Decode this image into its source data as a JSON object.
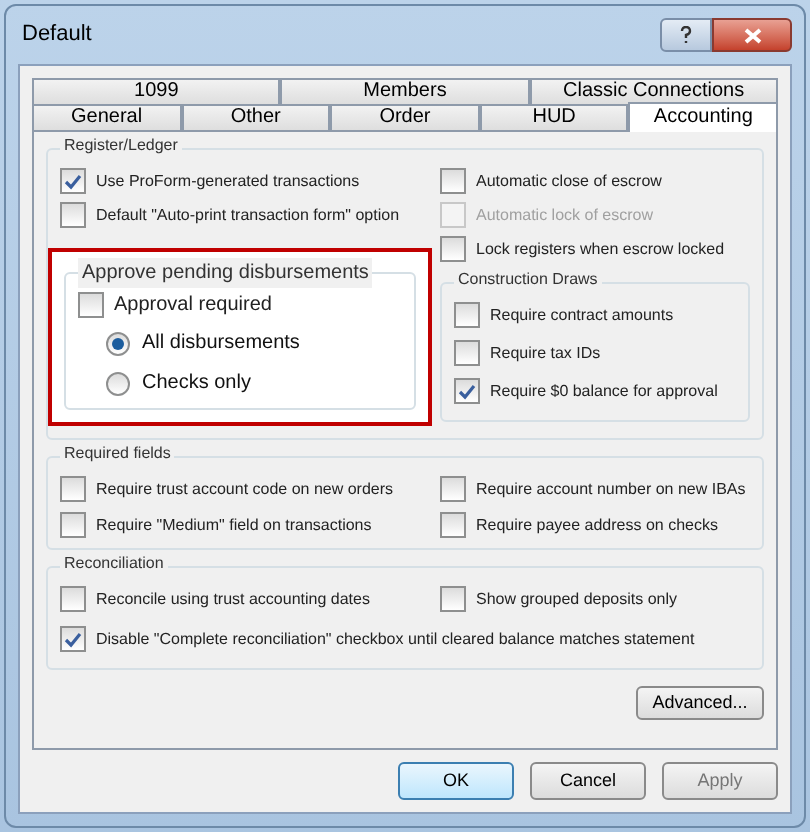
{
  "window": {
    "title": "Default"
  },
  "tab_rows": [
    [
      {
        "label": "1099",
        "selected": false
      },
      {
        "label": "Members",
        "selected": false
      },
      {
        "label": "Classic Connections",
        "selected": false
      }
    ],
    [
      {
        "label": "General",
        "selected": false
      },
      {
        "label": "Other",
        "selected": false
      },
      {
        "label": "Order",
        "selected": false
      },
      {
        "label": "HUD",
        "selected": false
      },
      {
        "label": "Accounting",
        "selected": true
      }
    ]
  ],
  "register_ledger": {
    "title": "Register/Ledger",
    "left": [
      {
        "label": "Use ProForm-generated transactions",
        "checked": true,
        "disabled": false
      },
      {
        "label": "Default \"Auto-print transaction form\" option",
        "checked": false,
        "disabled": false
      }
    ],
    "right": [
      {
        "label": "Automatic close of escrow",
        "checked": false,
        "disabled": false
      },
      {
        "label": "Automatic lock of escrow",
        "checked": false,
        "disabled": true
      },
      {
        "label": "Lock registers when escrow locked",
        "checked": false,
        "disabled": false
      }
    ]
  },
  "approve_pending": {
    "title": "Approve pending disbursements",
    "highlighted": true,
    "approval_required": {
      "label": "Approval required",
      "checked": false,
      "disabled": false
    },
    "scope": [
      {
        "label": "All disbursements",
        "selected": true
      },
      {
        "label": "Checks only",
        "selected": false
      }
    ]
  },
  "construction_draws": {
    "title": "Construction Draws",
    "options": [
      {
        "label": "Require contract amounts",
        "checked": false,
        "disabled": false
      },
      {
        "label": "Require tax IDs",
        "checked": false,
        "disabled": false
      },
      {
        "label": "Require $0 balance for approval",
        "checked": true,
        "disabled": false
      }
    ]
  },
  "required_fields": {
    "title": "Required fields",
    "options": [
      {
        "label": "Require trust account code on new orders",
        "checked": false,
        "disabled": false
      },
      {
        "label": "Require account number on new IBAs",
        "checked": false,
        "disabled": false
      },
      {
        "label": "Require \"Medium\" field on transactions",
        "checked": false,
        "disabled": false
      },
      {
        "label": "Require payee address on checks",
        "checked": false,
        "disabled": false
      }
    ]
  },
  "reconciliation": {
    "title": "Reconciliation",
    "rows": [
      [
        {
          "label": "Reconcile using trust accounting dates",
          "checked": false,
          "disabled": false
        },
        {
          "label": "Show grouped deposits only",
          "checked": false,
          "disabled": false
        }
      ],
      [
        {
          "label": "Disable \"Complete reconciliation\" checkbox until cleared balance matches statement",
          "checked": true,
          "disabled": false
        }
      ]
    ]
  },
  "advanced_button": "Advanced...",
  "buttons": [
    {
      "label": "OK",
      "default": true,
      "disabled": false
    },
    {
      "label": "Cancel",
      "default": false,
      "disabled": false
    },
    {
      "label": "Apply",
      "default": false,
      "disabled": true
    }
  ]
}
